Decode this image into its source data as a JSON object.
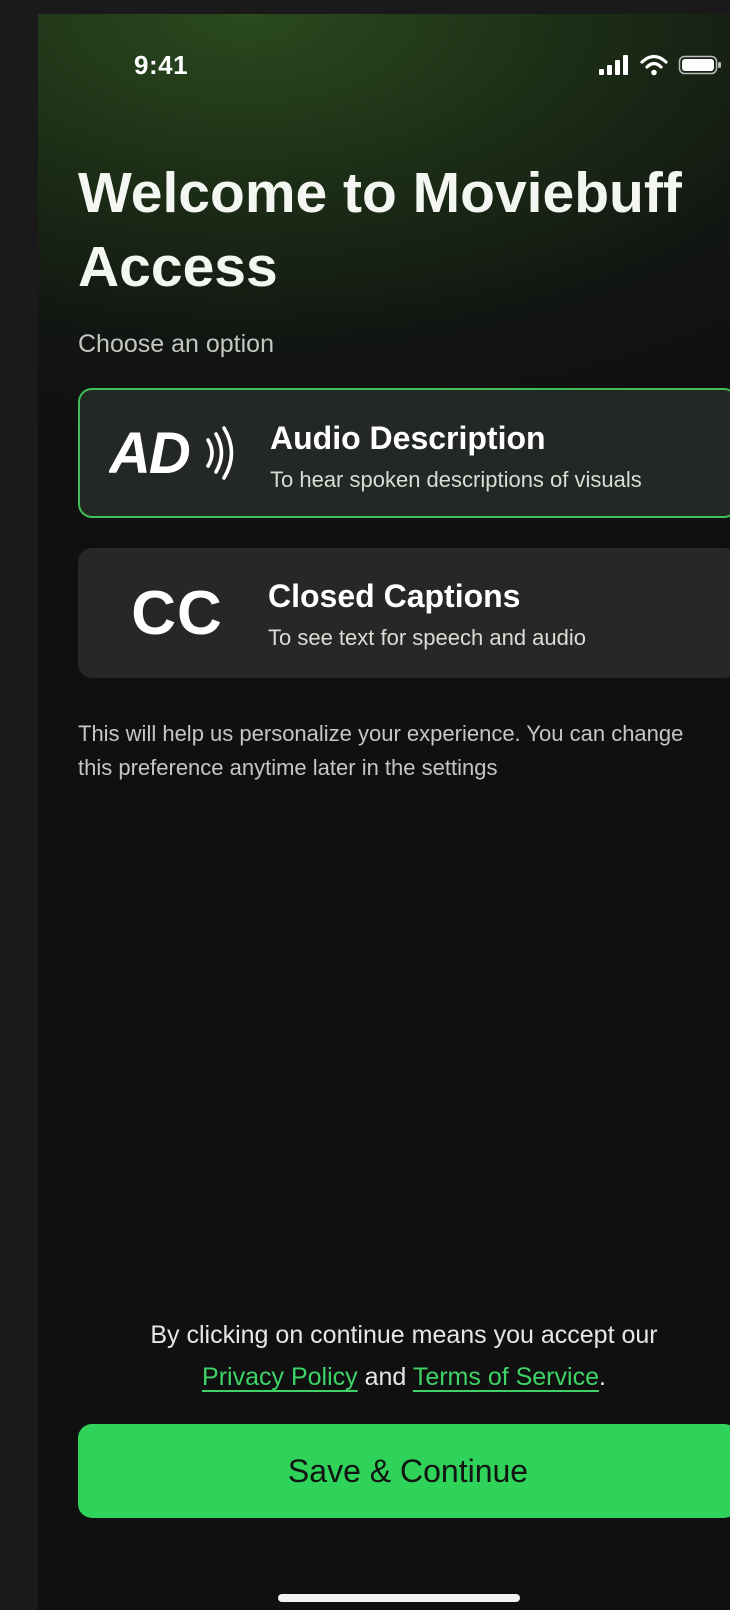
{
  "status_bar": {
    "time": "9:41",
    "icons": [
      "cellular-signal-icon",
      "wifi-icon",
      "battery-icon"
    ]
  },
  "header": {
    "title": "Welcome to Moviebuff Access",
    "subtitle": "Choose an option"
  },
  "options": [
    {
      "icon": "audio-description-icon",
      "title": "Audio Description",
      "description": "To hear spoken descriptions of visuals",
      "selected": true
    },
    {
      "icon": "closed-captions-icon",
      "icon_text": "CC",
      "title": "Closed Captions",
      "description": "To see text for speech and audio",
      "selected": false
    }
  ],
  "helper_text": "This will help us personalize your experience. You can change this preference anytime later in the settings",
  "legal": {
    "prefix": "By clicking on continue means you accept our",
    "privacy_link": "Privacy Policy",
    "joiner": "and",
    "terms_link": "Terms of Service",
    "suffix": "."
  },
  "continue_button": {
    "label": "Save & Continue"
  },
  "colors": {
    "accent": "#2fd35a",
    "link": "#3fd367",
    "background": "#101010",
    "card": "#262826"
  }
}
